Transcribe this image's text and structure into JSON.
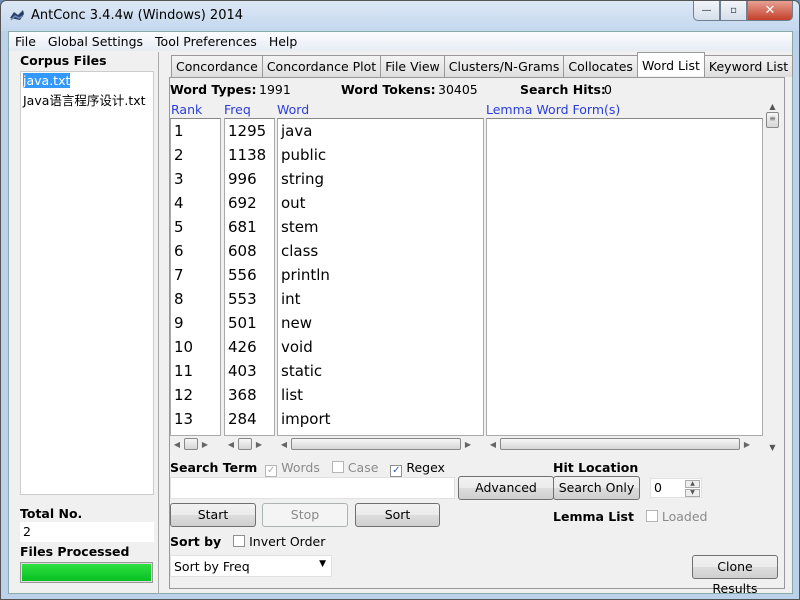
{
  "window": {
    "title": "AntConc 3.4.4w (Windows) 2014",
    "controls": {
      "minimize": "—",
      "maximize": "▫",
      "close": "✕"
    }
  },
  "menu": [
    "File",
    "Global Settings",
    "Tool Preferences",
    "Help"
  ],
  "left_panel": {
    "corpus_label": "Corpus Files",
    "files": [
      {
        "name": "java.txt",
        "selected": true
      },
      {
        "name": "Java语言程序设计.txt",
        "selected": false
      }
    ],
    "total_label": "Total No.",
    "total_value": "2",
    "processed_label": "Files Processed",
    "progress_percent": 100,
    "progress_color": "#06c023"
  },
  "tabs": [
    {
      "label": "Concordance",
      "active": false
    },
    {
      "label": "Concordance Plot",
      "active": false
    },
    {
      "label": "File View",
      "active": false
    },
    {
      "label": "Clusters/N-Grams",
      "active": false
    },
    {
      "label": "Collocates",
      "active": false
    },
    {
      "label": "Word List",
      "active": true
    },
    {
      "label": "Keyword List",
      "active": false
    }
  ],
  "stats": {
    "word_types_label": "Word Types:",
    "word_types": "1991",
    "word_tokens_label": "Word Tokens:",
    "word_tokens": "30405",
    "search_hits_label": "Search Hits:",
    "search_hits": "0"
  },
  "columns": {
    "rank": "Rank",
    "freq": "Freq",
    "word": "Word",
    "lemma": "Lemma Word Form(s)"
  },
  "rows": [
    {
      "rank": "1",
      "freq": "1295",
      "word": "java"
    },
    {
      "rank": "2",
      "freq": "1138",
      "word": "public"
    },
    {
      "rank": "3",
      "freq": "996",
      "word": "string"
    },
    {
      "rank": "4",
      "freq": "692",
      "word": "out"
    },
    {
      "rank": "5",
      "freq": "681",
      "word": "stem"
    },
    {
      "rank": "6",
      "freq": "608",
      "word": "class"
    },
    {
      "rank": "7",
      "freq": "556",
      "word": "println"
    },
    {
      "rank": "8",
      "freq": "553",
      "word": "int"
    },
    {
      "rank": "9",
      "freq": "501",
      "word": "new"
    },
    {
      "rank": "10",
      "freq": "426",
      "word": "void"
    },
    {
      "rank": "11",
      "freq": "403",
      "word": "static"
    },
    {
      "rank": "12",
      "freq": "368",
      "word": "list"
    },
    {
      "rank": "13",
      "freq": "284",
      "word": "import"
    }
  ],
  "search": {
    "label": "Search Term",
    "words_label": "Words",
    "words_checked": true,
    "case_label": "Case",
    "case_checked": false,
    "regex_label": "Regex",
    "regex_checked": true,
    "input_value": "",
    "advanced_label": "Advanced"
  },
  "buttons": {
    "start": "Start",
    "stop": "Stop",
    "sort": "Sort",
    "clone": "Clone Results"
  },
  "hit_location": {
    "label": "Hit Location",
    "search_only": "Search Only",
    "value": "0"
  },
  "lemma": {
    "label": "Lemma List",
    "loaded_label": "Loaded",
    "loaded_checked": false
  },
  "sort": {
    "label": "Sort by",
    "invert_label": "Invert Order",
    "invert_checked": false,
    "selected": "Sort by Freq"
  }
}
